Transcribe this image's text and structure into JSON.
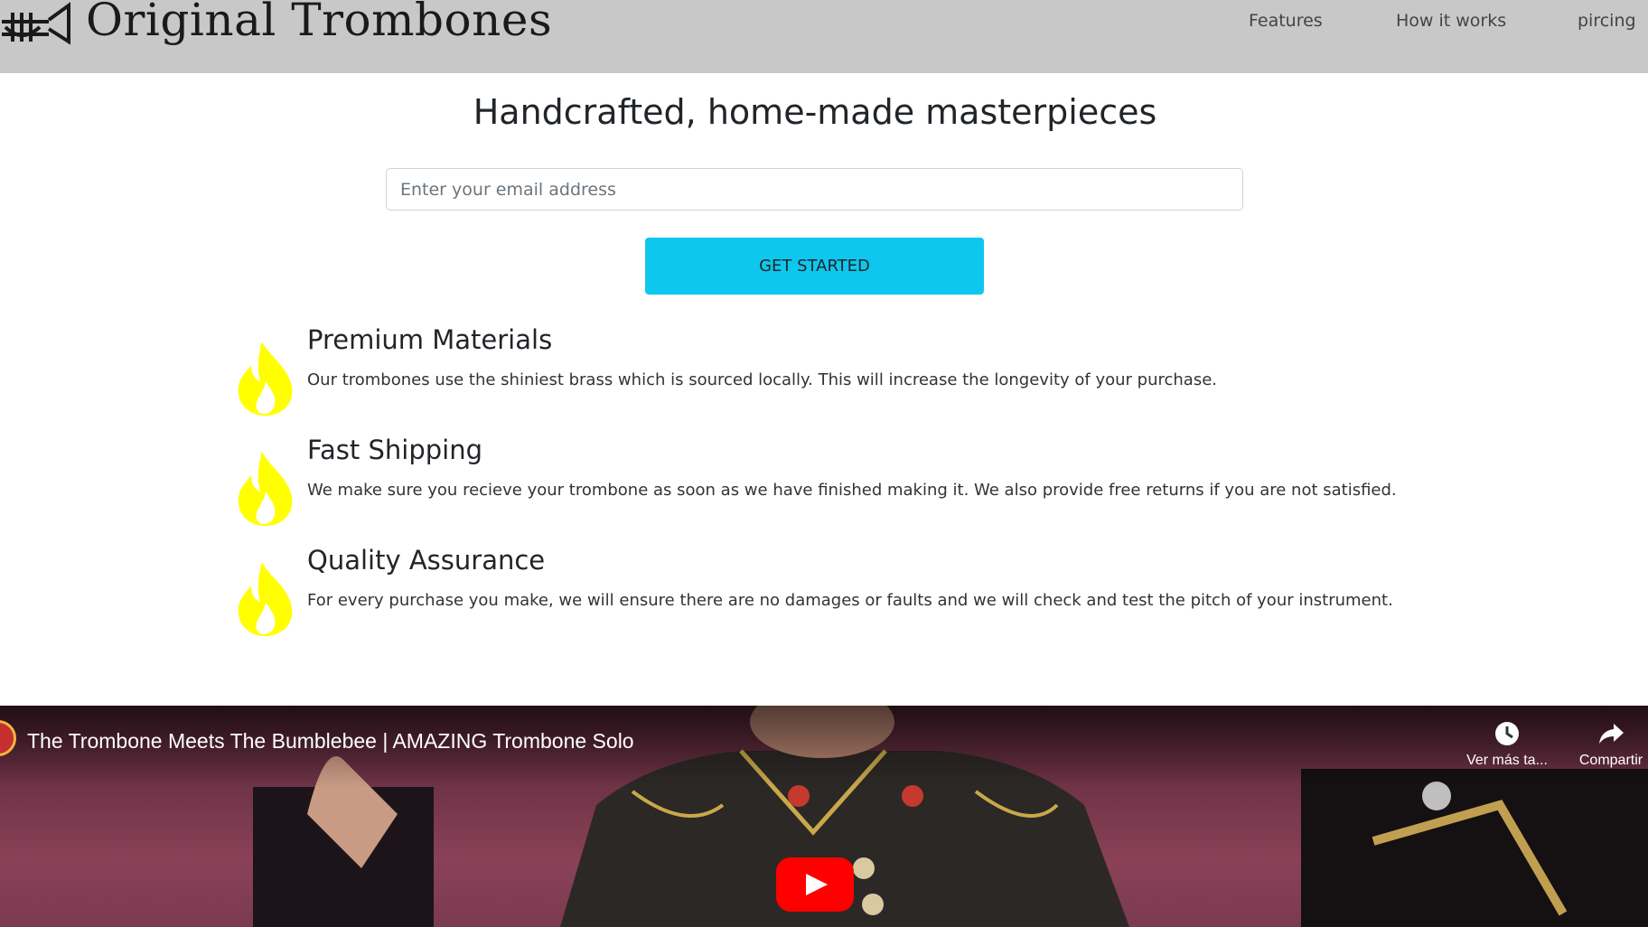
{
  "header": {
    "brand": "Original Trombones",
    "nav": [
      {
        "label": "Features"
      },
      {
        "label": "How it works"
      },
      {
        "label": "pircing"
      }
    ]
  },
  "hero": {
    "title": "Handcrafted, home-made masterpieces",
    "email_placeholder": "Enter your email address",
    "cta_label": "GET STARTED"
  },
  "features": [
    {
      "icon": "flame-icon",
      "title": "Premium Materials",
      "text": "Our trombones use the shiniest brass which is sourced locally. This will increase the longevity of your purchase."
    },
    {
      "icon": "flame-icon",
      "title": "Fast Shipping",
      "text": "We make sure you recieve your trombone as soon as we have finished making it. We also provide free returns if you are not satisfied."
    },
    {
      "icon": "flame-icon",
      "title": "Quality Assurance",
      "text": "For every purchase you make, we will ensure there are no damages or faults and we will check and test the pitch of your instrument."
    }
  ],
  "video": {
    "title": "The Trombone Meets The Bumblebee | AMAZING Trombone Solo",
    "watch_later_label": "Ver más ta...",
    "share_label": "Compartir"
  },
  "colors": {
    "header_bg": "#c8c8c8",
    "cta_bg": "#0ec7ee",
    "flame": "#ffff00",
    "youtube_red": "#ff0000"
  }
}
